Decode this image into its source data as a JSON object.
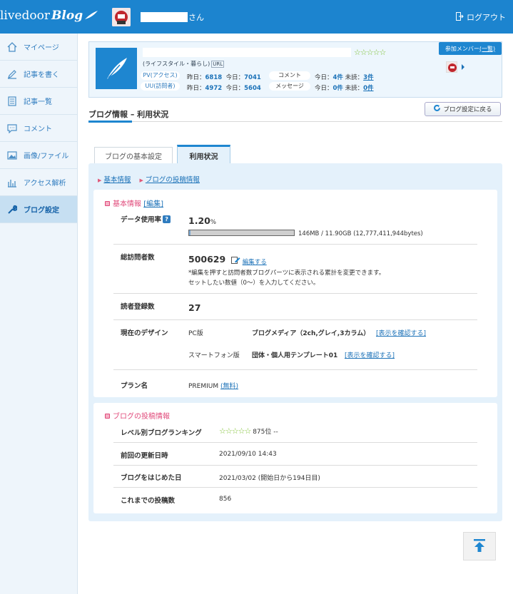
{
  "header": {
    "logo_prefix": "livedoor",
    "logo_blog": "Blog",
    "user_suffix": "さん",
    "logout_label": "ログアウト"
  },
  "sidebar": {
    "items": [
      {
        "label": "マイページ",
        "icon": "home-icon"
      },
      {
        "label": "記事を書く",
        "icon": "pencil-icon"
      },
      {
        "label": "記事一覧",
        "icon": "document-list-icon"
      },
      {
        "label": "コメント",
        "icon": "comment-icon"
      },
      {
        "label": "画像/ファイル",
        "icon": "image-icon"
      },
      {
        "label": "アクセス解析",
        "icon": "bar-chart-icon"
      },
      {
        "label": "ブログ設定",
        "icon": "wrench-icon",
        "active": true
      }
    ]
  },
  "profile": {
    "stars": "☆☆☆☆☆",
    "category": "(ライフスタイル・暮らし)",
    "url_badge": "URL",
    "pv_label": "PV(アクセス)",
    "uu_label": "UU(訪問者)",
    "pv_yesterday_label": "昨日：",
    "pv_yesterday": "6818",
    "pv_today_label": "今日：",
    "pv_today": "7041",
    "uu_yesterday_label": "昨日：",
    "uu_yesterday": "4972",
    "uu_today_label": "今日：",
    "uu_today": "5604",
    "comment_label": "コメント",
    "message_label": "メッセージ",
    "comment_today_label": "今日：",
    "comment_today": "4件",
    "comment_unread_label": "未読：",
    "comment_unread": "3件",
    "message_today_label": "今日：",
    "message_today": "0件",
    "message_unread_label": "未読：",
    "message_unread": "0件",
    "member_label": "参加メンバー",
    "member_list": "(一覧)"
  },
  "page": {
    "title": "ブログ情報 – 利用状況",
    "back_button": "ブログ設定に戻る",
    "tab_basic": "ブログの基本設定",
    "tab_usage": "利用状況",
    "anchor_basic": "基本情報",
    "anchor_posts": "ブログの投稿情報"
  },
  "basic": {
    "heading": "基本情報",
    "edit_link": "[編集]",
    "data_usage_label": "データ使用率",
    "help_mark": "?",
    "data_usage_value": "1.20",
    "data_usage_unit": "%",
    "data_usage_fraction": 0.012,
    "storage_detail": "146MB / 11.90GB (12,777,411,944bytes)",
    "visitors_label": "総訪問者数",
    "visitors_value": "500629",
    "visitors_edit": "編集する",
    "visitors_note1": "*編集を押すと訪問者数ブログパーツに表示される累計を変更できます。",
    "visitors_note2": "セットしたい数値（0〜）を入力してください。",
    "readers_label": "読者登録数",
    "readers_value": "27",
    "design_label": "現在のデザイン",
    "pc_label": "PC版",
    "pc_design": "ブログメディア（2ch,グレイ,3カラム）",
    "pc_link": "[表示を確認する]",
    "sp_label": "スマートフォン版",
    "sp_design": "団体・個人用テンプレート01",
    "sp_link": "[表示を確認する]",
    "plan_label": "プラン名",
    "plan_value": "PREMIUM",
    "plan_free": "(無料)"
  },
  "posts": {
    "heading": "ブログの投稿情報",
    "ranking_label": "レベル別ブログランキング",
    "ranking_stars": "☆☆☆☆☆",
    "ranking_value": "875位 --",
    "last_update_label": "前回の更新日時",
    "last_update_value": "2021/09/10 14:43",
    "start_label": "ブログをはじめた日",
    "start_value": "2021/03/02 (開始日から194日目)",
    "count_label": "これまでの投稿数",
    "count_value": "856"
  }
}
